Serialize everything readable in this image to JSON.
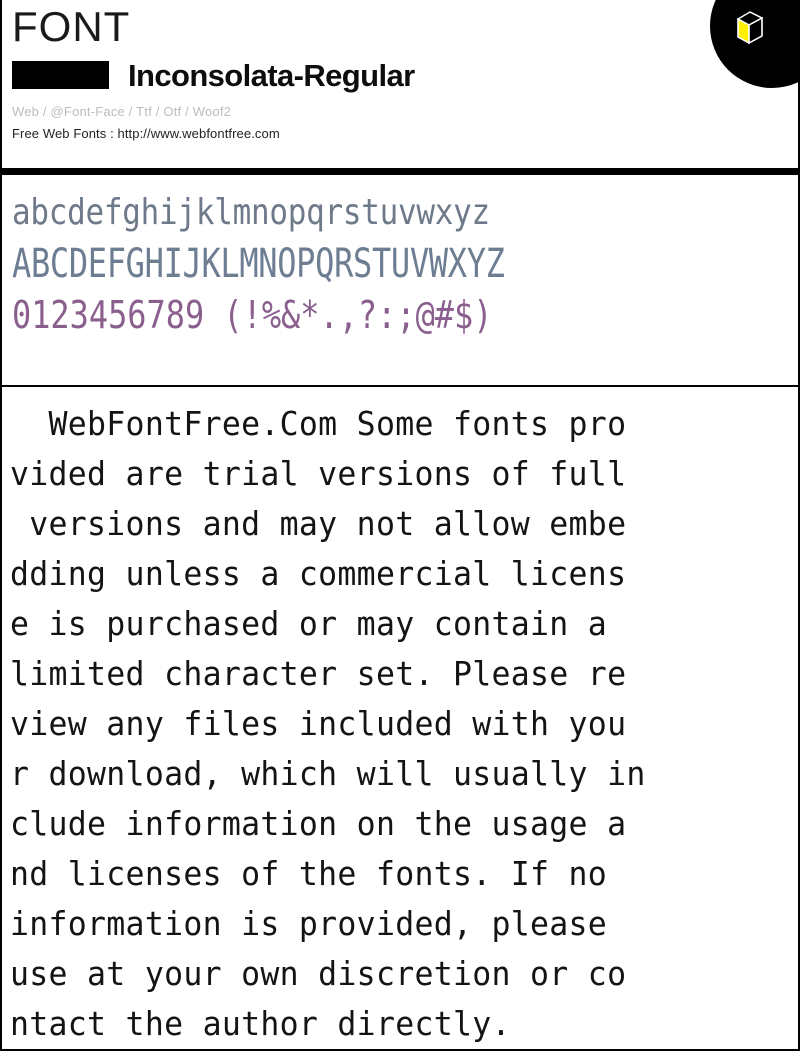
{
  "header": {
    "section_label": "FONT",
    "font_name": "Inconsolata-Regular",
    "formats": "Web / @Font-Face / Ttf / Otf / Woof2",
    "site_line": "Free Web Fonts : http://www.webfontfree.com",
    "logo_colors": {
      "circle": "#000000",
      "cube_face": "#ffef00",
      "cube_outline": "#ffffff"
    }
  },
  "glyph_preview": {
    "lowercase": "abcdefghijklmnopqrstuvwxyz",
    "uppercase": "ABCDEFGHIJKLMNOPQRSTUVWXYZ",
    "digits_symbols": "0123456789 (!%&*.,?:;@#$)",
    "colors": {
      "lowercase": "#6e7a8a",
      "uppercase": "#6d7d92",
      "digits_symbols": "#8a5f8e"
    }
  },
  "sample_text": {
    "full": "  WebFontFree.Com Some fonts provided are trial versions of full versions and may not allow embedding unless a commercial license is purchased or may contain a limited character set. Please review any files included with your download, which will usually include information on the usage and licenses of the fonts. If no information is provided, please use at your own discretion or contact the author directly.",
    "lines": [
      "  WebFontFree.Com Some fonts pro",
      "vided are trial versions of full",
      " versions and may not allow embe",
      "dding unless a commercial licens",
      "e is purchased or may contain a",
      "limited character set. Please re",
      "view any files included with you",
      "r download, which will usually in",
      "clude information on the usage a",
      "nd licenses of the fonts. If no",
      "information is provided, please",
      "use at your own discretion or co",
      "ntact the author directly."
    ],
    "color": "#141414"
  }
}
